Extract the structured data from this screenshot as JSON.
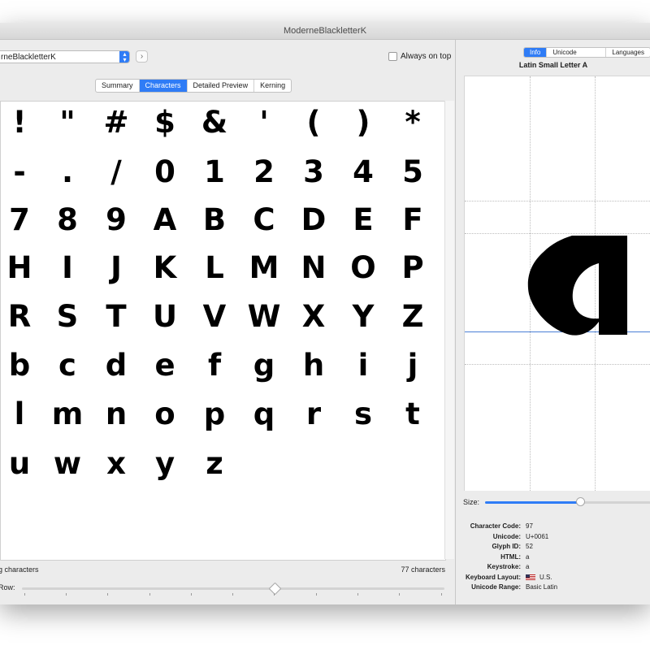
{
  "window": {
    "title": "ModerneBlackletterK"
  },
  "toolbar": {
    "font_name": "rneBlackletterK",
    "nav_icon": "chevron-right-icon",
    "always_on_top_label": "Always on top",
    "always_on_top_checked": false
  },
  "tabs": [
    "Summary",
    "Characters",
    "Detailed Preview",
    "Kerning"
  ],
  "active_tab": "Characters",
  "glyph_rows": [
    [
      "!",
      "\"",
      "#",
      "$",
      "&",
      "'",
      "(",
      ")",
      "*"
    ],
    [
      "-",
      ".",
      "/",
      "0",
      "1",
      "2",
      "3",
      "4",
      "5"
    ],
    [
      "7",
      "8",
      "9",
      "A",
      "B",
      "C",
      "D",
      "E",
      "F"
    ],
    [
      "H",
      "I",
      "J",
      "K",
      "L",
      "M",
      "N",
      "O",
      "P"
    ],
    [
      "R",
      "S",
      "T",
      "U",
      "V",
      "W",
      "X",
      "Y",
      "Z"
    ],
    [
      "b",
      "c",
      "d",
      "e",
      "f",
      "g",
      "h",
      "i",
      "j"
    ],
    [
      "l",
      "m",
      "n",
      "o",
      "p",
      "q",
      "r",
      "s",
      "t"
    ],
    [
      "u",
      "w",
      "x",
      "y",
      "z"
    ]
  ],
  "status": {
    "left": "g characters",
    "right": "77 characters",
    "row_label": "Row:"
  },
  "right_panel": {
    "tabs": [
      "Info",
      "Unicode Options",
      "Languages"
    ],
    "active_tab": "Info",
    "glyph_name": "Latin Small Letter A",
    "size_label": "Size:",
    "info": [
      {
        "key": "Character Code:",
        "value": "97"
      },
      {
        "key": "Unicode:",
        "value": "U+0061"
      },
      {
        "key": "Glyph ID:",
        "value": "52"
      },
      {
        "key": "HTML:",
        "value": "a"
      },
      {
        "key": "Keystroke:",
        "value": "a"
      },
      {
        "key": "Keyboard Layout:",
        "value": "U.S."
      },
      {
        "key": "Unicode Range:",
        "value": "Basic Latin"
      }
    ]
  },
  "colors": {
    "accent": "#2f7cf6",
    "baseline": "#4a7fd6"
  }
}
